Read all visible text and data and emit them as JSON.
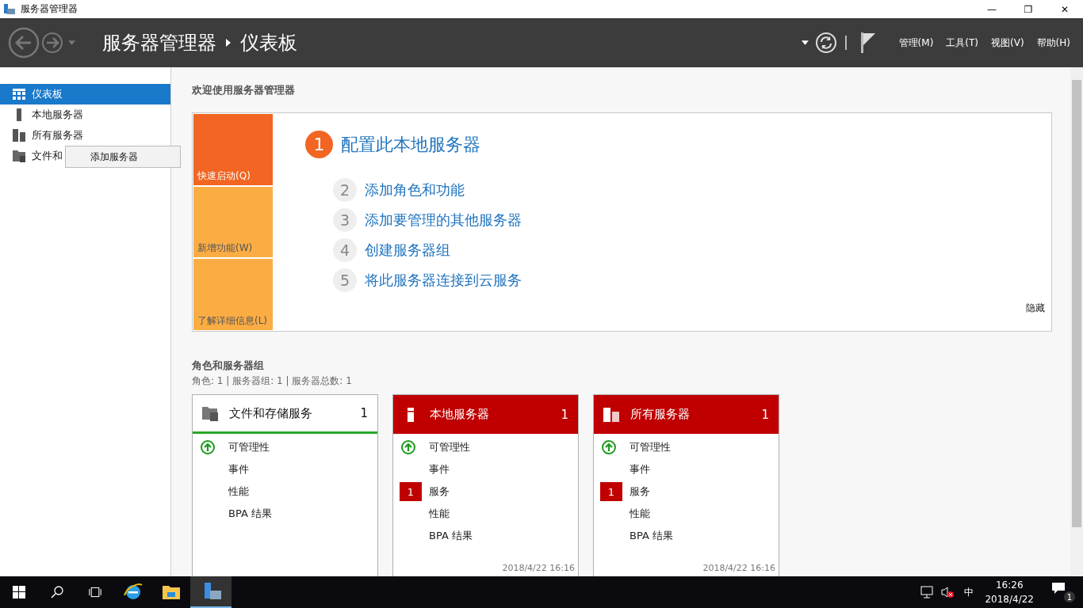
{
  "window": {
    "title": "服务器管理器",
    "controls": [
      "—",
      "❐",
      "✕"
    ]
  },
  "header": {
    "breadcrumb": [
      "服务器管理器",
      "仪表板"
    ],
    "menus": [
      "管理(M)",
      "工具(T)",
      "视图(V)",
      "帮助(H)"
    ]
  },
  "sidebar": {
    "items": [
      {
        "label": "仪表板",
        "kind": "dashboard",
        "selected": true
      },
      {
        "label": "本地服务器",
        "kind": "local",
        "selected": false
      },
      {
        "label": "所有服务器",
        "kind": "all",
        "selected": false
      },
      {
        "label": "文件和",
        "kind": "files",
        "selected": false
      }
    ]
  },
  "context_menu": {
    "items": [
      "添加服务器"
    ]
  },
  "welcome": {
    "title": "欢迎使用服务器管理器",
    "side_tabs": [
      {
        "label": "快速启动(Q)",
        "selected": true
      },
      {
        "label": "新增功能(W)",
        "selected": false
      },
      {
        "label": "了解详细信息(L)",
        "selected": false
      }
    ],
    "steps": [
      {
        "number": "1",
        "label": "配置此本地服务器",
        "primary": true
      },
      {
        "number": "2",
        "label": "添加角色和功能",
        "primary": false
      },
      {
        "number": "3",
        "label": "添加要管理的其他服务器",
        "primary": false
      },
      {
        "number": "4",
        "label": "创建服务器组",
        "primary": false
      },
      {
        "number": "5",
        "label": "将此服务器连接到云服务",
        "primary": false
      }
    ],
    "hide": "隐藏"
  },
  "roles": {
    "title": "角色和服务器组",
    "summary": "角色: 1 | 服务器组: 1 | 服务器总数: 1",
    "tiles": [
      {
        "title": "文件和存储服务",
        "count": "1",
        "kind": "files",
        "alert": false,
        "rows": [
          {
            "label": "可管理性",
            "kind": "ok"
          },
          {
            "label": "事件",
            "kind": "plain"
          },
          {
            "label": "性能",
            "kind": "plain"
          },
          {
            "label": "BPA 结果",
            "kind": "plain"
          }
        ]
      },
      {
        "title": "本地服务器",
        "count": "1",
        "kind": "local",
        "alert": true,
        "rows": [
          {
            "label": "可管理性",
            "kind": "ok"
          },
          {
            "label": "事件",
            "kind": "plain"
          },
          {
            "label": "服务",
            "kind": "badge",
            "badge": "1"
          },
          {
            "label": "性能",
            "kind": "plain"
          },
          {
            "label": "BPA 结果",
            "kind": "plain"
          }
        ],
        "timestamp": "2018/4/22 16:16"
      },
      {
        "title": "所有服务器",
        "count": "1",
        "kind": "all",
        "alert": true,
        "rows": [
          {
            "label": "可管理性",
            "kind": "ok"
          },
          {
            "label": "事件",
            "kind": "plain"
          },
          {
            "label": "服务",
            "kind": "badge",
            "badge": "1"
          },
          {
            "label": "性能",
            "kind": "plain"
          },
          {
            "label": "BPA 结果",
            "kind": "plain"
          }
        ],
        "timestamp": "2018/4/22 16:16"
      }
    ]
  },
  "taskbar": {
    "tray_ime": "中",
    "time": "16:26",
    "date": "2018/4/22",
    "notification_count": "1"
  }
}
